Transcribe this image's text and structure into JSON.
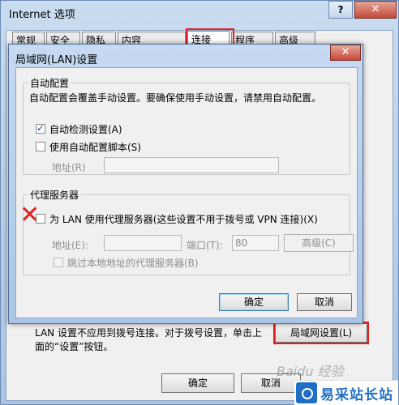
{
  "outer": {
    "title": "Internet 选项",
    "help": "?",
    "close": "✕",
    "tabs": [
      "常规",
      "安全",
      "隐私",
      "内容",
      "连接",
      "程序",
      "高级"
    ],
    "lan_description": "LAN 设置不应用到拨号连接。对于拨号设置，单击上面的“设置”按钮。",
    "lan_settings_button": "局域网设置(L)",
    "ok": "确定",
    "cancel": "取消"
  },
  "dialog": {
    "title": "局域网(LAN)设置",
    "close": "✕",
    "auto_config": {
      "legend": "自动配置",
      "description": "自动配置会覆盖手动设置。要确保使用手动设置，请禁用自动配置。",
      "auto_detect_label": "自动检测设置(A)",
      "auto_detect_checked": true,
      "use_script_label": "使用自动配置脚本(S)",
      "use_script_checked": false,
      "address_label": "地址(R)",
      "address_value": ""
    },
    "proxy": {
      "legend": "代理服务器",
      "use_proxy_label": "为 LAN 使用代理服务器(这些设置不用于拨号或 VPN 连接)(X)",
      "use_proxy_checked": false,
      "address_label": "地址(E):",
      "address_value": "",
      "port_label": "端口(T):",
      "port_value": "80",
      "advanced_button": "高级(C)",
      "bypass_label": "跳过本地地址的代理服务器(B)",
      "bypass_checked": false
    },
    "ok": "确定",
    "cancel": "取消"
  },
  "annotations": {
    "red_x": "✕",
    "watermark": "Baidu 经验",
    "brand": "易采站长站"
  },
  "colors": {
    "highlight_red": "#e02020",
    "title_gradient_top": "#c6daf2",
    "brand_blue": "#1f6fc4"
  }
}
